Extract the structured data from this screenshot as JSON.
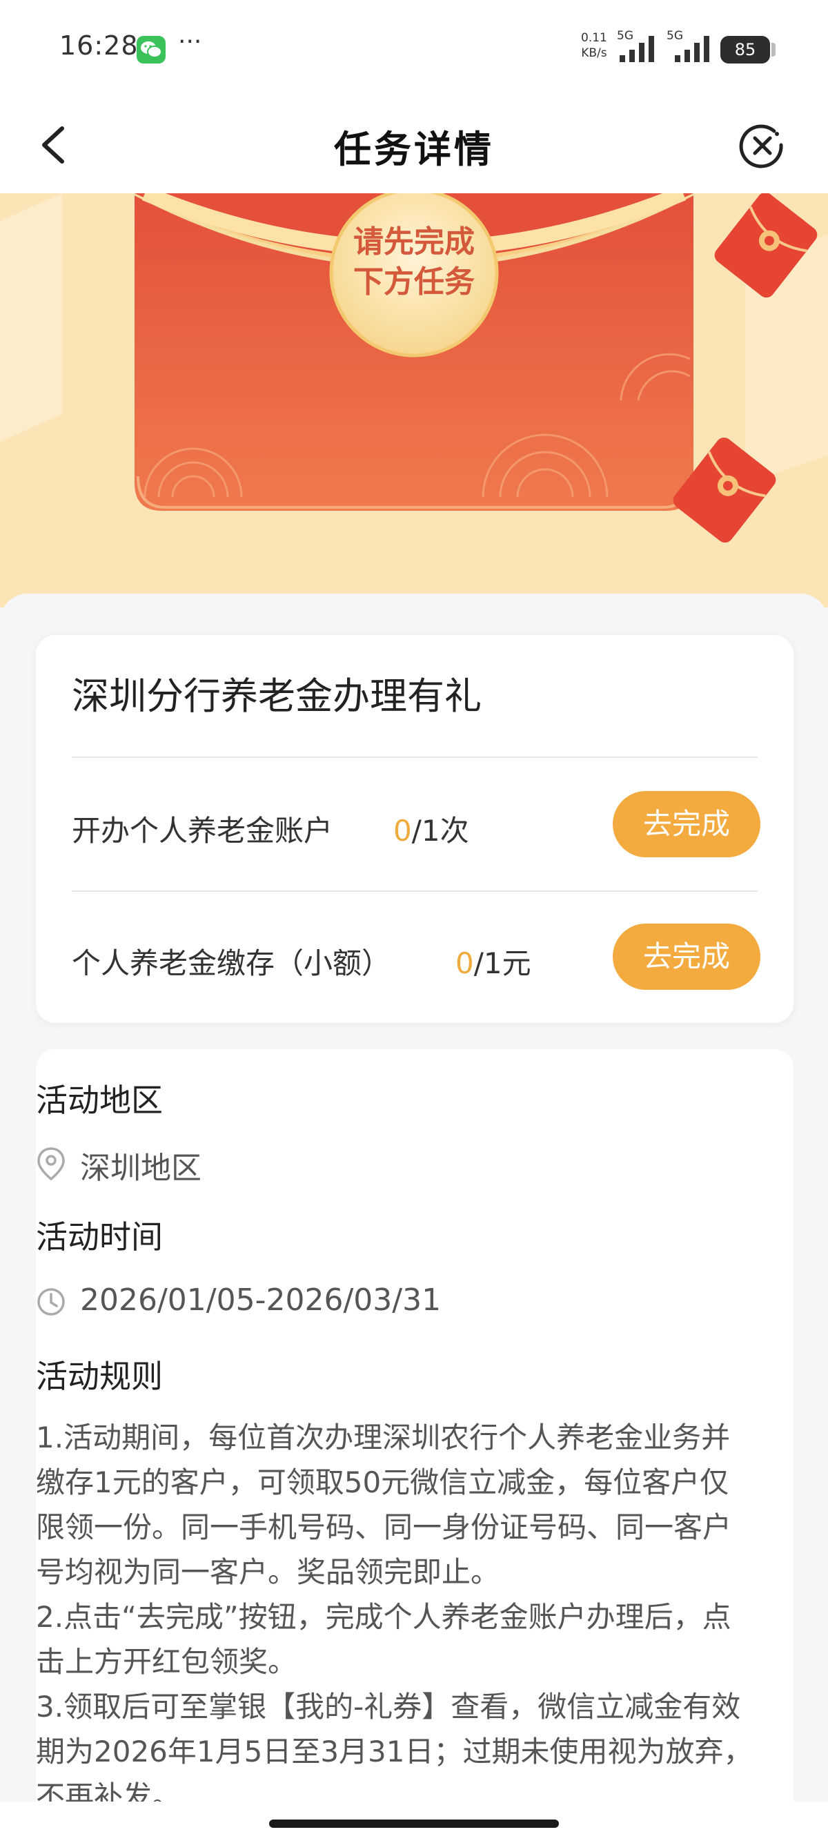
{
  "status_bar": {
    "time": "16:28",
    "app_icon": "wechat-icon",
    "more": "···",
    "net_speed_value": "0.11",
    "net_speed_unit": "KB/s",
    "sim1": "5G",
    "sim2": "5G",
    "battery": "85"
  },
  "nav": {
    "title": "任务详情",
    "back_icon": "chevron-left-icon",
    "close_icon": "close-circle-icon"
  },
  "banner": {
    "seal_line1": "请先完成",
    "seal_line2": "下方任务"
  },
  "task_card": {
    "title": "深圳分行养老金办理有礼",
    "tasks": [
      {
        "label": "开办个人养老金账户",
        "done": "0",
        "total": "/1次",
        "button": "去完成"
      },
      {
        "label": "个人养老金缴存（小额）",
        "done": "0",
        "total": "/1元",
        "button": "去完成"
      }
    ]
  },
  "details": {
    "region_title": "活动地区",
    "region_value": "深圳地区",
    "time_title": "活动时间",
    "time_value": "2026/01/05-2026/03/31",
    "rules_title": "活动规则",
    "rules": [
      "1.活动期间，每位首次办理深圳农行个人养老金业务并缴存1元的客户，可领取50元微信立减金，每位客户仅限领一份。同一手机号码、同一身份证号码、同一客户号均视为同一客户。奖品领完即止。",
      "2.点击“去完成”按钮，完成个人养老金账户办理后，点击上方开红包领奖。",
      "3.领取后可至掌银【我的-礼券】查看，微信立减金有效期为2026年1月5日至3月31日；过期未使用视为放弃，不再补发。"
    ]
  },
  "colors": {
    "accent": "#f3ab3f",
    "progress_done": "#f0aa3c",
    "envelope_red": "#e8573c",
    "banner_bg": "#fce9c0"
  }
}
